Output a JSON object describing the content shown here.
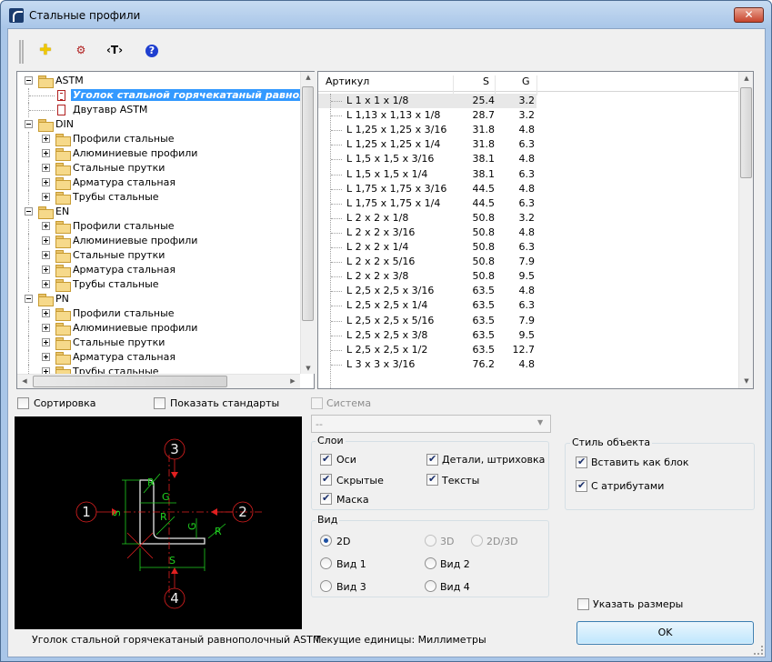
{
  "window": {
    "title": "Стальные профили",
    "close_glyph": "✕"
  },
  "toolbar": {
    "buttons": [
      {
        "name": "add-icon",
        "glyph": "✚",
        "color": "#f0c800"
      },
      {
        "name": "profile-settings-icon",
        "glyph": "⚙",
        "color": "#b02020"
      },
      {
        "name": "text-attribute-icon",
        "glyph": "‹T›",
        "color": "#000000"
      },
      {
        "name": "help-icon",
        "glyph": "?",
        "color": "#1f3fd0"
      }
    ]
  },
  "tree": {
    "items": [
      {
        "label": "ASTM",
        "level": 0,
        "type": "folder",
        "expanded": true
      },
      {
        "label": "Уголок стальной горячекатаный равнопол",
        "level": 1,
        "type": "doc",
        "selected": true
      },
      {
        "label": "Двутавр ASTM",
        "level": 1,
        "type": "doc"
      },
      {
        "label": "DIN",
        "level": 0,
        "type": "folder",
        "expanded": true
      },
      {
        "label": "Профили стальные",
        "level": 1,
        "type": "folder"
      },
      {
        "label": "Алюминиевые профили",
        "level": 1,
        "type": "folder"
      },
      {
        "label": "Стальные прутки",
        "level": 1,
        "type": "folder"
      },
      {
        "label": "Арматура стальная",
        "level": 1,
        "type": "folder"
      },
      {
        "label": "Трубы стальные",
        "level": 1,
        "type": "folder"
      },
      {
        "label": "EN",
        "level": 0,
        "type": "folder",
        "expanded": true
      },
      {
        "label": "Профили стальные",
        "level": 1,
        "type": "folder"
      },
      {
        "label": "Алюминиевые профили",
        "level": 1,
        "type": "folder"
      },
      {
        "label": "Стальные прутки",
        "level": 1,
        "type": "folder"
      },
      {
        "label": "Арматура стальная",
        "level": 1,
        "type": "folder"
      },
      {
        "label": "Трубы стальные",
        "level": 1,
        "type": "folder"
      },
      {
        "label": "PN",
        "level": 0,
        "type": "folder",
        "expanded": true
      },
      {
        "label": "Профили стальные",
        "level": 1,
        "type": "folder"
      },
      {
        "label": "Алюминиевые профили",
        "level": 1,
        "type": "folder"
      },
      {
        "label": "Стальные прутки",
        "level": 1,
        "type": "folder"
      },
      {
        "label": "Арматура стальная",
        "level": 1,
        "type": "folder"
      },
      {
        "label": "Трубы стальные",
        "level": 1,
        "type": "folder"
      }
    ]
  },
  "table": {
    "headers": [
      "Артикул",
      "S",
      "G"
    ],
    "rows": [
      [
        "L 1 x 1 x 1/8",
        "25.4",
        "3.2"
      ],
      [
        "L 1,13 x 1,13 x 1/8",
        "28.7",
        "3.2"
      ],
      [
        "L 1,25 x 1,25 x 3/16",
        "31.8",
        "4.8"
      ],
      [
        "L 1,25 x 1,25 x 1/4",
        "31.8",
        "6.3"
      ],
      [
        "L 1,5 x 1,5 x 3/16",
        "38.1",
        "4.8"
      ],
      [
        "L 1,5 x 1,5 x 1/4",
        "38.1",
        "6.3"
      ],
      [
        "L 1,75 x 1,75 x 3/16",
        "44.5",
        "4.8"
      ],
      [
        "L 1,75 x 1,75 x 1/4",
        "44.5",
        "6.3"
      ],
      [
        "L 2 x 2 x 1/8",
        "50.8",
        "3.2"
      ],
      [
        "L 2 x 2 x 3/16",
        "50.8",
        "4.8"
      ],
      [
        "L 2 x 2 x 1/4",
        "50.8",
        "6.3"
      ],
      [
        "L 2 x 2 x 5/16",
        "50.8",
        "7.9"
      ],
      [
        "L 2 x 2 x 3/8",
        "50.8",
        "9.5"
      ],
      [
        "L 2,5 x 2,5 x 3/16",
        "63.5",
        "4.8"
      ],
      [
        "L 2,5 x 2,5 x 1/4",
        "63.5",
        "6.3"
      ],
      [
        "L 2,5 x 2,5 x 5/16",
        "63.5",
        "7.9"
      ],
      [
        "L 2,5 x 2,5 x 3/8",
        "63.5",
        "9.5"
      ],
      [
        "L 2,5 x 2,5 x 1/2",
        "63.5",
        "12.7"
      ],
      [
        "L 3 x 3 x 3/16",
        "76.2",
        "4.8"
      ]
    ]
  },
  "options": {
    "sort_label": "Сортировка",
    "show_standards_label": "Показать стандарты",
    "system_label": "Система",
    "system_value": "--"
  },
  "preview": {
    "caption": "Уголок стальной горячекатаный равнополочный ASTM",
    "marker_labels": [
      "1",
      "2",
      "3",
      "4"
    ],
    "dim_labels": {
      "s": "S",
      "g": "G",
      "r": "R"
    }
  },
  "layers": {
    "title": "Слои",
    "axes": "Оси",
    "details": "Детали, штриховка",
    "hidden": "Скрытые",
    "texts": "Тексты",
    "mask": "Маска"
  },
  "view": {
    "title": "Вид",
    "r2d": "2D",
    "r3d": "3D",
    "r2d3d": "2D/3D",
    "v1": "Вид 1",
    "v2": "Вид 2",
    "v3": "Вид 3",
    "v4": "Вид 4"
  },
  "style": {
    "title": "Стиль объекта",
    "insert_block": "Вставить как блок",
    "with_attributes": "С атрибутами"
  },
  "specify_sizes_label": "Указать размеры",
  "units_text": "Текущие единицы: Миллиметры",
  "ok_label": "OK"
}
